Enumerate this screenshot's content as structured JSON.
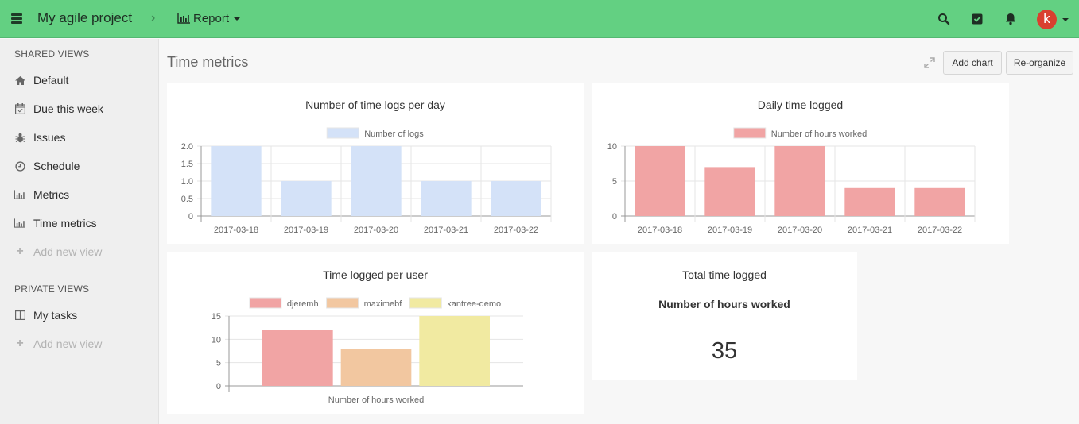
{
  "topbar": {
    "project": "My agile project",
    "section": "Report",
    "icons": [
      "menu-icon",
      "search-icon",
      "tasks-check-icon",
      "bell-icon"
    ],
    "avatar_letter": "k",
    "colors": {
      "bar": "#63d082",
      "avatar": "#d9402f"
    }
  },
  "sidebar": {
    "shared_header": "SHARED VIEWS",
    "shared_items": [
      {
        "label": "Default",
        "icon": "home-icon"
      },
      {
        "label": "Due this week",
        "icon": "calendar-check-icon"
      },
      {
        "label": "Issues",
        "icon": "bug-icon"
      },
      {
        "label": "Schedule",
        "icon": "clock-icon"
      },
      {
        "label": "Metrics",
        "icon": "bar-chart-icon"
      },
      {
        "label": "Time metrics",
        "icon": "bar-chart-icon"
      }
    ],
    "add_view": "Add new view",
    "private_header": "PRIVATE VIEWS",
    "private_items": [
      {
        "label": "My tasks",
        "icon": "columns-icon"
      }
    ],
    "add_view_private": "Add new view"
  },
  "main": {
    "title": "Time metrics",
    "add_chart": "Add chart",
    "reorganize": "Re-organize"
  },
  "total": {
    "title": "Total time logged",
    "label": "Number of hours worked",
    "value": "35"
  },
  "chart_data": [
    {
      "type": "bar",
      "title": "Number of time logs per day",
      "categories": [
        "2017-03-18",
        "2017-03-19",
        "2017-03-20",
        "2017-03-21",
        "2017-03-22"
      ],
      "series": [
        {
          "name": "Number of logs",
          "values": [
            2,
            1,
            2,
            1,
            1
          ],
          "color": "#d4e2f8"
        }
      ],
      "yticks": [
        "0",
        "0.5",
        "1.0",
        "1.5",
        "2.0"
      ],
      "ylim": [
        0,
        2
      ],
      "xlabel": "",
      "ylabel": "",
      "grid": true,
      "legend": "top"
    },
    {
      "type": "bar",
      "title": "Daily time logged",
      "categories": [
        "2017-03-18",
        "2017-03-19",
        "2017-03-20",
        "2017-03-21",
        "2017-03-22"
      ],
      "series": [
        {
          "name": "Number of hours worked",
          "values": [
            10,
            7,
            10,
            4,
            4
          ],
          "color": "#f1a4a4"
        }
      ],
      "yticks": [
        "0",
        "5",
        "10"
      ],
      "ylim": [
        0,
        10
      ],
      "xlabel": "",
      "ylabel": "",
      "grid": true,
      "legend": "top"
    },
    {
      "type": "bar",
      "title": "Time logged per user",
      "categories": [
        "Number of hours worked"
      ],
      "series": [
        {
          "name": "djeremh",
          "values": [
            12
          ],
          "color": "#f1a4a4"
        },
        {
          "name": "maximebf",
          "values": [
            8
          ],
          "color": "#f2c7a0"
        },
        {
          "name": "kantree-demo",
          "values": [
            15
          ],
          "color": "#f1eaa1"
        }
      ],
      "yticks": [
        "0",
        "5",
        "10",
        "15"
      ],
      "ylim": [
        0,
        15
      ],
      "xlabel": "",
      "ylabel": "",
      "grid": true,
      "legend": "top"
    }
  ]
}
